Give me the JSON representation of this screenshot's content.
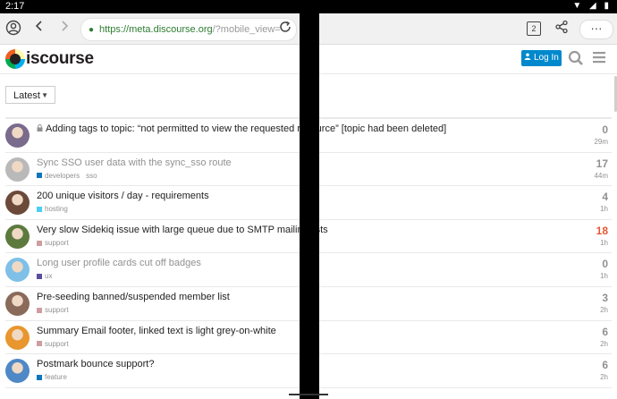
{
  "status": {
    "time": "2:17",
    "icons": "▼ ◢ ▮"
  },
  "browser": {
    "url_host": "https://meta.discourse.org",
    "url_path": "/?mobile_view=",
    "tab_count": "2",
    "more": "···"
  },
  "site": {
    "logo_text": "iscourse",
    "login_label": "Log In"
  },
  "filter": {
    "label": "Latest"
  },
  "colors": {
    "accent": "#0088cc",
    "hot": "#e45735",
    "muted": "#919191"
  },
  "topics": [
    {
      "title": "Adding tags to topic: “not permitted to view the requested resource” [topic had been deleted]",
      "locked": true,
      "visited": false,
      "category": "",
      "cat_color": "",
      "tag": "",
      "count": "0",
      "hot": false,
      "age": "29m",
      "avatar": "#7a6a8c"
    },
    {
      "title": "Sync SSO user data with the sync_sso route",
      "locked": false,
      "visited": true,
      "category": "developers",
      "cat_color": "#0e76bd",
      "tag": "sso",
      "count": "17",
      "hot": false,
      "age": "44m",
      "avatar": "#b9b9b9"
    },
    {
      "title": "200 unique visitors / day - requirements",
      "locked": false,
      "visited": false,
      "category": "hosting",
      "cat_color": "#49d0f2",
      "tag": "",
      "count": "4",
      "hot": false,
      "age": "1h",
      "avatar": "#6b4a3a"
    },
    {
      "title": "Very slow Sidekiq issue with large queue due to SMTP mailing lists",
      "locked": false,
      "visited": false,
      "category": "support",
      "cat_color": "#ce9da0",
      "tag": "",
      "count": "18",
      "hot": true,
      "age": "1h",
      "avatar": "#5d7a3e"
    },
    {
      "title": "Long user profile cards cut off badges",
      "locked": false,
      "visited": true,
      "category": "ux",
      "cat_color": "#5c4c9c",
      "tag": "",
      "count": "0",
      "hot": false,
      "age": "1h",
      "avatar": "#7ec0e8"
    },
    {
      "title": "Pre-seeding banned/suspended member list",
      "locked": false,
      "visited": false,
      "category": "support",
      "cat_color": "#ce9da0",
      "tag": "",
      "count": "3",
      "hot": false,
      "age": "2h",
      "avatar": "#8a6a5a"
    },
    {
      "title": "Summary Email footer, linked text is light grey-on-white",
      "locked": false,
      "visited": false,
      "category": "support",
      "cat_color": "#ce9da0",
      "tag": "",
      "count": "6",
      "hot": false,
      "age": "2h",
      "avatar": "#e8962e"
    },
    {
      "title": "Postmark bounce support?",
      "locked": false,
      "visited": false,
      "category": "feature",
      "cat_color": "#0e76bd",
      "tag": "",
      "count": "6",
      "hot": false,
      "age": "2h",
      "avatar": "#4f88c6"
    }
  ]
}
